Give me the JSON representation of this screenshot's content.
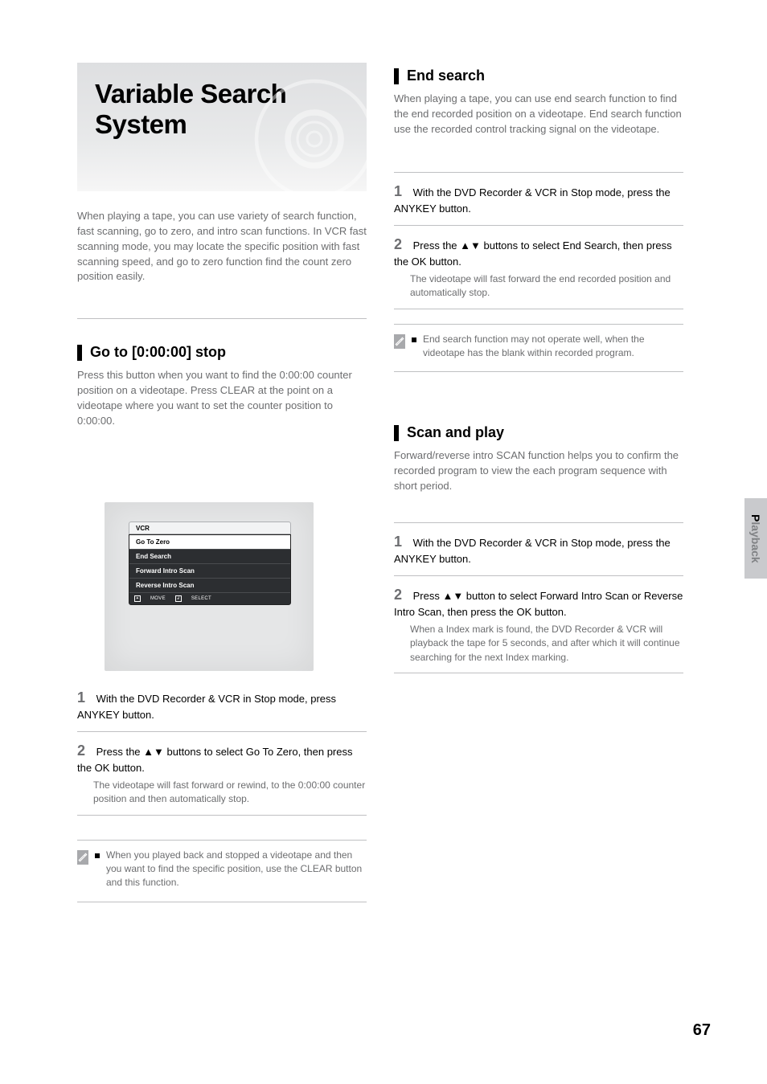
{
  "title": "Variable Search System",
  "intro": "When playing a tape, you can use variety of search function, fast scanning, go to zero, and intro scan functions. In VCR fast scanning mode, you may locate the specific position with fast scanning speed, and go to zero function find the count zero position easily.",
  "sections": {
    "goToZero": {
      "heading": "Go to [0:00:00] stop",
      "desc": "Press this button when you want to find the 0:00:00 counter position on a videotape. Press CLEAR at the point on a videotape where you want to set the counter position to 0:00:00."
    },
    "endSearch": {
      "heading": "End search",
      "desc": "When playing a tape, you can use end search function to find the end recorded position on a videotape. End search function use the recorded control tracking signal on the videotape."
    },
    "scanAndPlay": {
      "heading": "Scan and play",
      "desc": "Forward/reverse intro SCAN function helps you to confirm the recorded program to view the each program sequence with short period."
    }
  },
  "menu": {
    "header": "VCR",
    "items": [
      "Go To Zero",
      "End Search",
      "Forward Intro Scan",
      "Reverse Intro Scan"
    ],
    "foot1": "MOVE",
    "foot2": "SELECT"
  },
  "stepsLeft": [
    {
      "num": "1",
      "text": "With the DVD Recorder & VCR in Stop mode, press ANYKEY button."
    },
    {
      "num": "2",
      "text": "Press the ▲▼ buttons to select Go To Zero, then press the OK button.",
      "sub": "The videotape will fast forward or rewind, to the 0:00:00 counter position and then automatically stop."
    }
  ],
  "noteLeft": "When you played back and stopped a videotape and then you want to find the specific position, use the CLEAR button and this function.",
  "stepsRight1": [
    {
      "num": "1",
      "text": "With the DVD Recorder & VCR in Stop mode, press the ANYKEY button."
    },
    {
      "num": "2",
      "text": "Press the ▲▼ buttons to select End Search, then press the OK button.",
      "sub": "The videotape will fast forward the end recorded position and automatically stop."
    }
  ],
  "noteRight1": "End search function may not operate well, when the videotape has the blank within recorded program.",
  "stepsRight2": [
    {
      "num": "1",
      "text": "With the DVD Recorder & VCR in Stop mode, press the ANYKEY button."
    },
    {
      "num": "2",
      "text": "Press ▲▼ button to select Forward Intro Scan or Reverse Intro Scan, then press the OK button.",
      "sub": "When a Index mark is found, the DVD Recorder & VCR will playback the tape for 5 seconds, and after which it will continue searching for the next Index marking."
    }
  ],
  "sideTabBold": "P",
  "sideTabRest": "layback",
  "pageNumber": "67"
}
